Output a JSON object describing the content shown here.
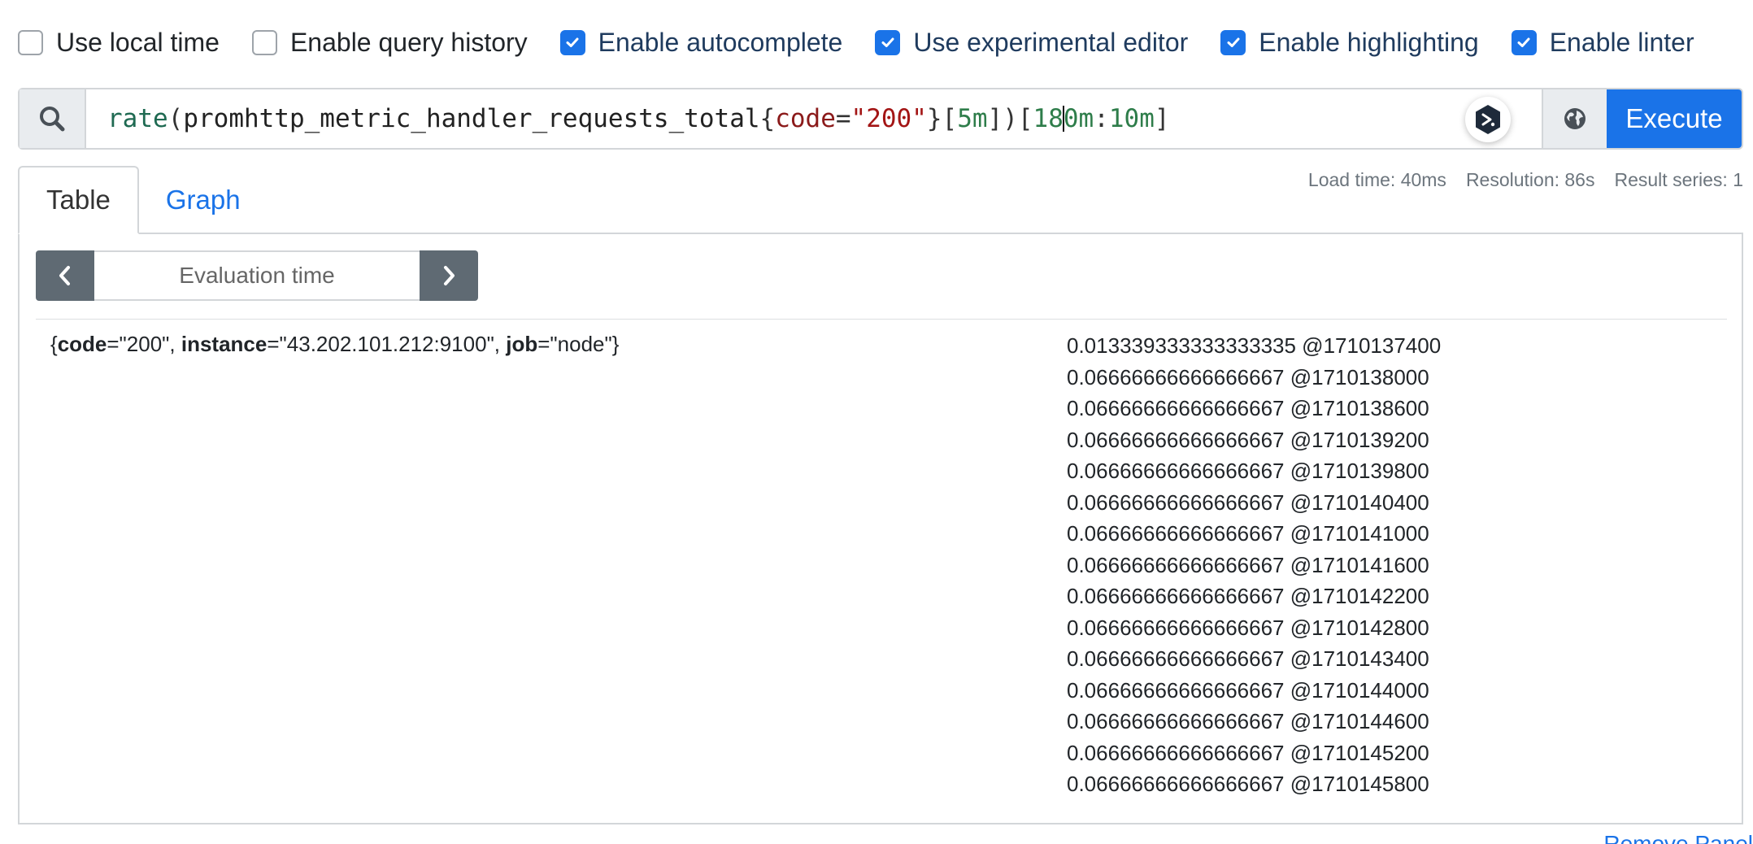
{
  "options": [
    {
      "label": "Use local time",
      "checked": false
    },
    {
      "label": "Enable query history",
      "checked": false
    },
    {
      "label": "Enable autocomplete",
      "checked": true
    },
    {
      "label": "Use experimental editor",
      "checked": true
    },
    {
      "label": "Enable highlighting",
      "checked": true
    },
    {
      "label": "Enable linter",
      "checked": true
    }
  ],
  "query": {
    "fn": "rate",
    "open_paren": "(",
    "metric": "promhttp_metric_handler_requests_total",
    "open_brace": "{",
    "label_name": "code",
    "eq": "=",
    "label_value": "\"200\"",
    "close_brace": "}",
    "range_open": "[",
    "range": "5m",
    "range_close": "])",
    "sub_open": "[",
    "sub_range_a": "18",
    "sub_range_b": "0m",
    "sub_colon": ":",
    "sub_step": "10m",
    "sub_close": "]"
  },
  "execute_label": "Execute",
  "tabs": [
    {
      "label": "Table",
      "active": true
    },
    {
      "label": "Graph",
      "active": false
    }
  ],
  "stats": {
    "load_time": "Load time: 40ms",
    "resolution": "Resolution: 86s",
    "result_series": "Result series: 1"
  },
  "eval_time_placeholder": "Evaluation time",
  "series": {
    "open": "{",
    "k1": "code",
    "v1": "=\"200\", ",
    "k2": "instance",
    "v2": "=\"43.202.101.212:9100\", ",
    "k3": "job",
    "v3": "=\"node\"",
    "close": "}"
  },
  "values": [
    "0.013339333333333335 @1710137400",
    "0.06666666666666667 @1710138000",
    "0.06666666666666667 @1710138600",
    "0.06666666666666667 @1710139200",
    "0.06666666666666667 @1710139800",
    "0.06666666666666667 @1710140400",
    "0.06666666666666667 @1710141000",
    "0.06666666666666667 @1710141600",
    "0.06666666666666667 @1710142200",
    "0.06666666666666667 @1710142800",
    "0.06666666666666667 @1710143400",
    "0.06666666666666667 @1710144000",
    "0.06666666666666667 @1710144600",
    "0.06666666666666667 @1710145200",
    "0.06666666666666667 @1710145800"
  ],
  "footer_link": "Remove Panel",
  "colors": {
    "accent": "#1a73e8",
    "button_dark": "#5f6a73"
  }
}
